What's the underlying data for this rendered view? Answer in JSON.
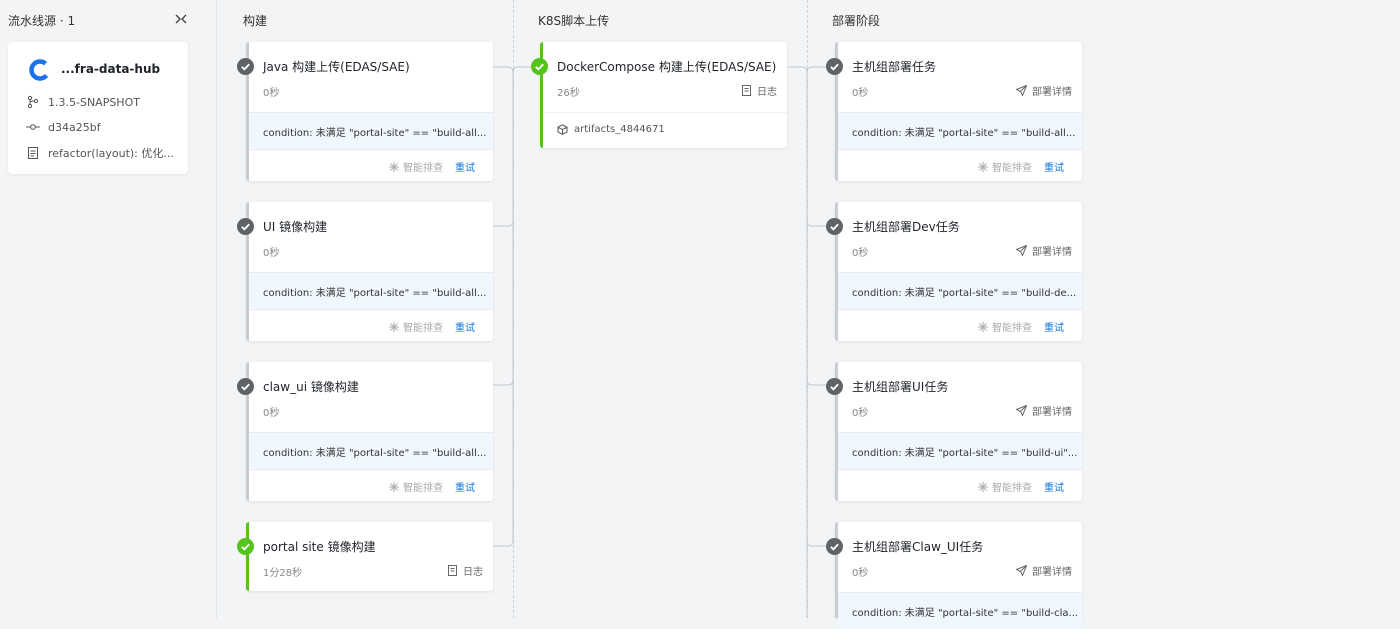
{
  "source": {
    "header": "流水线源 · 1",
    "repo_name": "...fra-data-hub",
    "version": "1.3.5-SNAPSHOT",
    "commit": "d34a25bf",
    "message": "refactor(layout): 优化..."
  },
  "stages": [
    {
      "title": "构建"
    },
    {
      "title": "K8S脚本上传"
    },
    {
      "title": "部署阶段"
    }
  ],
  "build_jobs": [
    {
      "title": "Java 构建上传(EDAS/SAE)",
      "duration": "0秒",
      "condition": "condition: 未满足 \"portal-site\" == \"build-all...",
      "smart": "智能排查",
      "retry": "重试"
    },
    {
      "title": "UI 镜像构建",
      "duration": "0秒",
      "condition": "condition: 未满足 \"portal-site\" == \"build-all...",
      "smart": "智能排查",
      "retry": "重试"
    },
    {
      "title": "claw_ui 镜像构建",
      "duration": "0秒",
      "condition": "condition: 未满足 \"portal-site\" == \"build-all...",
      "smart": "智能排查",
      "retry": "重试"
    },
    {
      "title": "portal site 镜像构建",
      "duration": "1分28秒",
      "log": "日志"
    }
  ],
  "k8s_job": {
    "title": "DockerCompose 构建上传(EDAS/SAE)",
    "duration": "26秒",
    "log": "日志",
    "artifact": "artifacts_4844671"
  },
  "deploy_jobs": [
    {
      "title": "主机组部署任务",
      "duration": "0秒",
      "detail": "部署详情",
      "condition": "condition: 未满足 \"portal-site\" == \"build-all...",
      "smart": "智能排查",
      "retry": "重试"
    },
    {
      "title": "主机组部署Dev任务",
      "duration": "0秒",
      "detail": "部署详情",
      "condition": "condition: 未满足 \"portal-site\" == \"build-de...",
      "smart": "智能排查",
      "retry": "重试"
    },
    {
      "title": "主机组部署UI任务",
      "duration": "0秒",
      "detail": "部署详情",
      "condition": "condition: 未满足 \"portal-site\" == \"build-ui\"...",
      "smart": "智能排查",
      "retry": "重试"
    },
    {
      "title": "主机组部署Claw_UI任务",
      "duration": "0秒",
      "detail": "部署详情",
      "condition": "condition: 未满足 \"portal-site\" == \"build-cla..."
    }
  ],
  "colors": {
    "success": "#52c41a",
    "skipped": "#5f6368",
    "accent": "#1677d4"
  }
}
